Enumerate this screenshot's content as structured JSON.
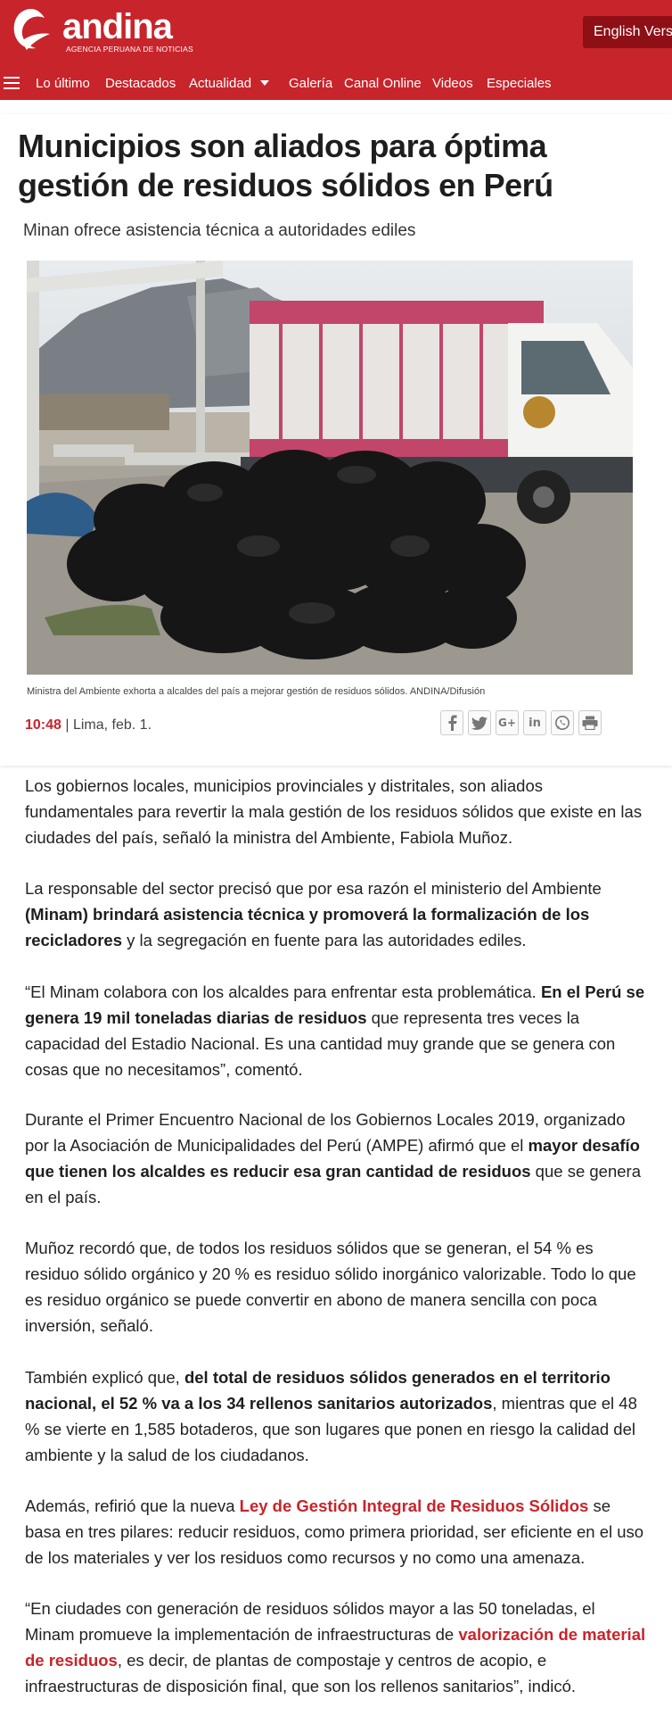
{
  "header": {
    "logo_text": "andina",
    "logo_sub": "AGENCIA PERUANA DE NOTICIAS",
    "english_label": "English Version",
    "brand_color": "#c8242b"
  },
  "nav": {
    "menu_icon": "hamburger-icon",
    "items": [
      "Lo último",
      "Destacados",
      "Actualidad",
      "Galería",
      "Canal Online",
      "Videos",
      "Especiales"
    ]
  },
  "article": {
    "title": "Municipios son aliados para óptima gestión de residuos sólidos en Perú",
    "subtitle": "Minan ofrece asistencia técnica a autoridades ediles",
    "caption": "Ministra del Ambiente exhorta a alcaldes del país a mejorar gestión de residuos sólidos. ANDINA/Difusión",
    "time": "10:48",
    "place_date": " | Lima, feb. 1.",
    "share_icons": [
      "facebook-icon",
      "twitter-icon",
      "google-plus-icon",
      "linkedin-icon",
      "whatsapp-icon",
      "print-icon"
    ],
    "p1": "Los gobiernos locales, municipios provinciales y distritales, son aliados fundamentales para revertir la mala gestión de los residuos sólidos que existe en las ciudades del país, señaló la ministra del Ambiente, Fabiola Muñoz.",
    "p2": {
      "a": "La responsable del sector precisó que por esa razón el ministerio del Ambiente ",
      "b": "(Minam) brindará asistencia técnica  y promoverá la formalización de los recicladores",
      "c": " y la segregación en fuente para las autoridades ediles."
    },
    "p3": {
      "a": "“El Minam colabora con los alcaldes para enfrentar esta problemática. ",
      "b": "En el Perú se genera 19 mil toneladas diarias de residuos",
      "c": " que representa tres veces la capacidad del Estadio Nacional. Es una cantidad muy grande que se genera con cosas que no necesitamos”, comentó."
    },
    "p4": {
      "a": "Durante el Primer Encuentro Nacional de los Gobiernos Locales 2019, organizado por la Asociación de Municipalidades del Perú (AMPE) afirmó que el ",
      "b": "mayor desafío que tienen los alcaldes es reducir esa gran cantidad de residuos",
      "c": " que se genera en el país."
    },
    "p5": "Muñoz recordó que, de todos los residuos sólidos que se generan, el 54 % es residuo sólido orgánico y 20 % es residuo sólido inorgánico valorizable. Todo lo que es residuo orgánico se puede convertir en abono de manera sencilla con poca inversión, señaló.",
    "p6": {
      "a": "También explicó que, ",
      "b": "del total de residuos sólidos generados en el territorio nacional, el 52 % va a los 34 rellenos sanitarios autorizados",
      "c": ", mientras que el 48 % se vierte en 1,585 botaderos, que son lugares que ponen en riesgo la calidad del ambiente y la salud de los ciudadanos."
    },
    "p7": {
      "a": "Además, refirió que la nueva ",
      "link": "Ley de Gestión Integral de Residuos Sólidos",
      "c": " se basa en tres pilares: reducir residuos, como primera prioridad, ser eficiente en el uso de los materiales y ver los residuos como recursos y no como una amenaza."
    },
    "p8": {
      "a": "“En ciudades con generación de residuos sólidos mayor a las 50 toneladas, el Minam promueve la implementación de infraestructuras de ",
      "link": "valorización de material de residuos",
      "c": ", es decir, de plantas de compostaje y centros de acopio, e infraestructuras de disposición final, que son los rellenos sanitarios”, indicó."
    }
  }
}
